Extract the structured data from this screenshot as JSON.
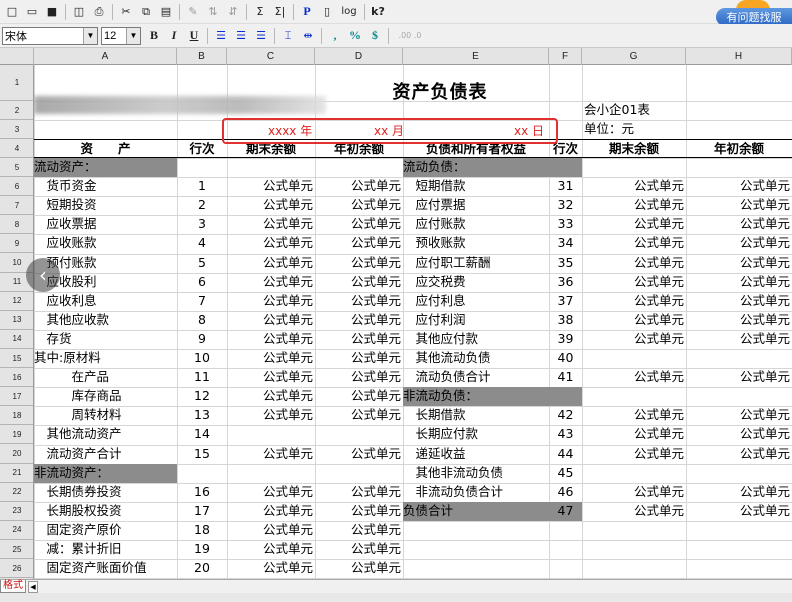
{
  "toolbar": {
    "font_name": "宋体",
    "font_size": "12",
    "bold": "B",
    "italic": "I",
    "underline": "U",
    "comma": ",",
    "percent": "%",
    "currency": "$",
    "decimals": ".00 .0",
    "p_btn": "P",
    "log_btn": "log",
    "help_btn": "k?",
    "sigma": "Σ",
    "sigma2": "Σ|"
  },
  "help_link": "有问题找服",
  "columns": [
    "A",
    "B",
    "C",
    "D",
    "E",
    "F",
    "G",
    "H"
  ],
  "report": {
    "title": "资产负债表",
    "form_no": "会小企01表",
    "unit": "单位：元",
    "year": "xxxx 年",
    "month": "xx 月",
    "day": "xx 日"
  },
  "header": {
    "asset": "资　　产",
    "line": "行次",
    "end_bal": "期末余额",
    "begin_bal": "年初余额",
    "liab": "负债和所有者权益",
    "line2": "行次",
    "end_bal2": "期末余额",
    "begin_bal2": "年初余额"
  },
  "formula": "公式单元",
  "rows": [
    {
      "r": "5",
      "a": "流动资产：",
      "a_gray": true,
      "b": "",
      "c": false,
      "d": false,
      "e": "流动负债：",
      "e_gray": true,
      "f": "",
      "g": false,
      "h": false
    },
    {
      "r": "6",
      "a": "　货币资金",
      "b": "1",
      "c": true,
      "d": true,
      "e": "　短期借款",
      "f": "31",
      "g": true,
      "h": true
    },
    {
      "r": "7",
      "a": "　短期投资",
      "b": "2",
      "c": true,
      "d": true,
      "e": "　应付票据",
      "f": "32",
      "g": true,
      "h": true
    },
    {
      "r": "8",
      "a": "　应收票据",
      "b": "3",
      "c": true,
      "d": true,
      "e": "　应付账款",
      "f": "33",
      "g": true,
      "h": true
    },
    {
      "r": "9",
      "a": "　应收账款",
      "b": "4",
      "c": true,
      "d": true,
      "e": "　预收账款",
      "f": "34",
      "g": true,
      "h": true
    },
    {
      "r": "10",
      "a": "　预付账款",
      "b": "5",
      "c": true,
      "d": true,
      "e": "　应付职工薪酬",
      "f": "35",
      "g": true,
      "h": true
    },
    {
      "r": "11",
      "a": "　应收股利",
      "b": "6",
      "c": true,
      "d": true,
      "e": "　应交税费",
      "f": "36",
      "g": true,
      "h": true
    },
    {
      "r": "12",
      "a": "　应收利息",
      "b": "7",
      "c": true,
      "d": true,
      "e": "　应付利息",
      "f": "37",
      "g": true,
      "h": true
    },
    {
      "r": "13",
      "a": "　其他应收款",
      "b": "8",
      "c": true,
      "d": true,
      "e": "　应付利润",
      "f": "38",
      "g": true,
      "h": true
    },
    {
      "r": "14",
      "a": "　存货",
      "b": "9",
      "c": true,
      "d": true,
      "e": "　其他应付款",
      "f": "39",
      "g": true,
      "h": true
    },
    {
      "r": "15",
      "a": "其中:原材料",
      "b": "10",
      "c": true,
      "d": true,
      "e": "　其他流动负债",
      "f": "40",
      "g": false,
      "h": false
    },
    {
      "r": "16",
      "a": "　　　在产品",
      "b": "11",
      "c": true,
      "d": true,
      "e": "　流动负债合计",
      "f": "41",
      "g": true,
      "h": true
    },
    {
      "r": "17",
      "a": "　　　库存商品",
      "b": "12",
      "c": true,
      "d": true,
      "e": "非流动负债：",
      "e_gray": true,
      "f": "",
      "g": false,
      "h": false
    },
    {
      "r": "18",
      "a": "　　　周转材料",
      "b": "13",
      "c": true,
      "d": true,
      "e": "　长期借款",
      "f": "42",
      "g": true,
      "h": true
    },
    {
      "r": "19",
      "a": "　其他流动资产",
      "b": "14",
      "c": false,
      "d": false,
      "e": "　长期应付款",
      "f": "43",
      "g": true,
      "h": true
    },
    {
      "r": "20",
      "a": "　流动资产合计",
      "b": "15",
      "c": true,
      "d": true,
      "e": "　递延收益",
      "f": "44",
      "g": true,
      "h": true
    },
    {
      "r": "21",
      "a": "非流动资产：",
      "a_gray": true,
      "b": "",
      "c": false,
      "d": false,
      "e": "　其他非流动负债",
      "f": "45",
      "g": false,
      "h": false
    },
    {
      "r": "22",
      "a": "　长期债券投资",
      "b": "16",
      "c": true,
      "d": true,
      "e": "　非流动负债合计",
      "f": "46",
      "g": true,
      "h": true
    },
    {
      "r": "23",
      "a": "　长期股权投资",
      "b": "17",
      "c": true,
      "d": true,
      "e": "负债合计",
      "e_gray": true,
      "f": "47",
      "g": true,
      "h": true
    },
    {
      "r": "24",
      "a": "　固定资产原价",
      "b": "18",
      "c": true,
      "d": true,
      "e": "",
      "f": "",
      "g": false,
      "h": false
    },
    {
      "r": "25",
      "a": "　减：累计折旧",
      "b": "19",
      "c": true,
      "d": true,
      "e": "",
      "f": "",
      "g": false,
      "h": false
    },
    {
      "r": "26",
      "a": "　固定资产账面价值",
      "b": "20",
      "c": true,
      "d": true,
      "e": "",
      "f": "",
      "g": false,
      "h": false
    }
  ],
  "top_rows": [
    "1",
    "2",
    "3",
    "4"
  ],
  "sheet_tab": "格式",
  "colors": {
    "highlight": "#e03030",
    "gray_cell": "#8c8c8c",
    "date_red": "#e02020"
  }
}
